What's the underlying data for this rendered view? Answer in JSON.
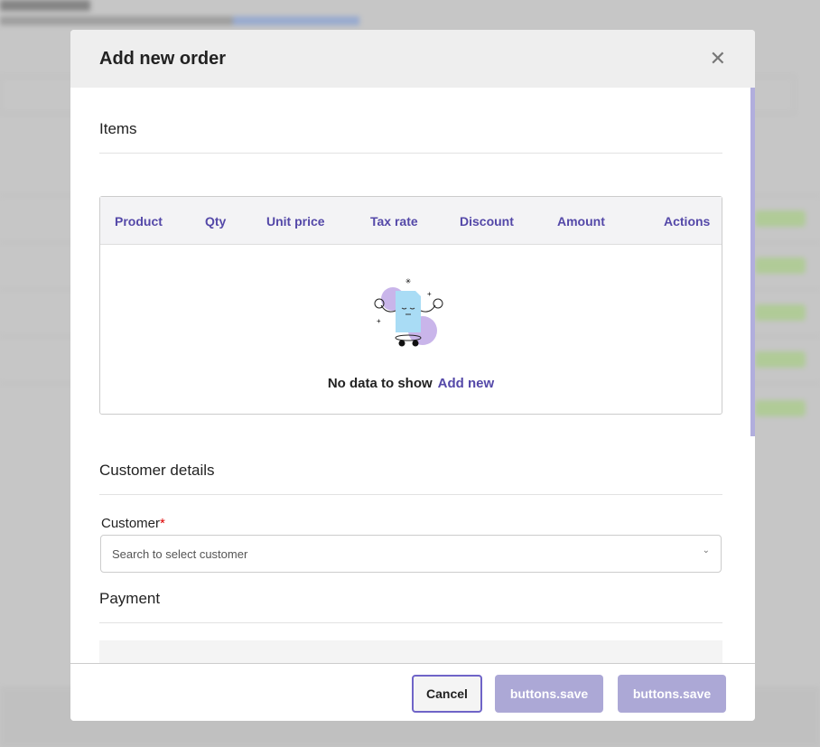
{
  "modal": {
    "title": "Add new order",
    "close_icon": "close-icon"
  },
  "items": {
    "heading": "Items",
    "columns": [
      "Product",
      "Qty",
      "Unit price",
      "Tax rate",
      "Discount",
      "Amount",
      "Actions"
    ],
    "empty_text": "No data to show",
    "add_new": "Add new"
  },
  "customer": {
    "heading": "Customer details",
    "label": "Customer",
    "required": "*",
    "placeholder": "Search to select customer"
  },
  "payment": {
    "heading": "Payment"
  },
  "footer": {
    "cancel": "Cancel",
    "save1": "buttons.save",
    "save2": "buttons.save"
  },
  "colors": {
    "accent": "#5448a8",
    "save_disabled": "#aca8d6"
  }
}
